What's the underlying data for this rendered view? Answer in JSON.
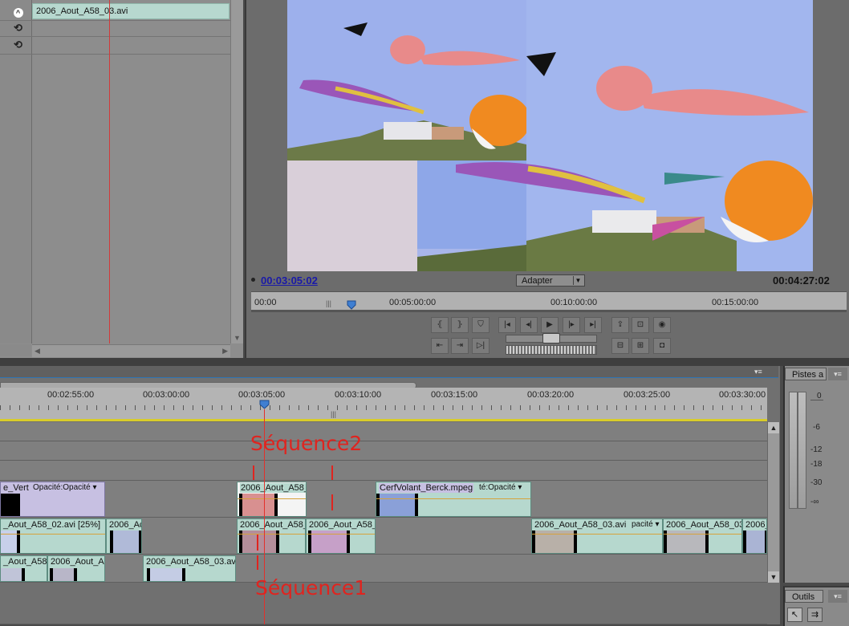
{
  "effect_controls": {
    "clip_name": "2006_Aout_A58_03.avi",
    "icons": [
      "toggle-effect-icon",
      "reset-icon",
      "reset-icon"
    ]
  },
  "monitor": {
    "current_time": "00:03:05:02",
    "duration": "00:04:27:02",
    "fit_option": "Adapter",
    "ruler_labels": [
      "00:00",
      "00:05:00:00",
      "00:10:00:00",
      "00:15:00:00"
    ]
  },
  "timeline": {
    "ruler_labels": [
      "00:02:55:00",
      "00:03:00:00",
      "00:03:05:00",
      "00:03:10:00",
      "00:03:15:00",
      "00:03:20:00",
      "00:03:25:00",
      "00:03:30:00"
    ],
    "track_v3": [
      {
        "name": "e_Vert",
        "suffix": "Opacité:Opacité",
        "style": "purple"
      },
      {
        "name": "2006_Aout_A58_",
        "suffix": ""
      },
      {
        "name": "CerfVolant_Berck.mpeg",
        "suffix": "té:Opacité"
      }
    ],
    "track_v2": [
      {
        "name": "_Aout_A58_02.avi [25%]"
      },
      {
        "name": "2006_Ac"
      },
      {
        "name": "2006_Aout_A58_"
      },
      {
        "name": "2006_Aout_A58_"
      },
      {
        "name": "2006_Aout_A58_03.avi",
        "suffix": "pacité"
      },
      {
        "name": "2006_Aout_A58_03"
      },
      {
        "name": "2006_"
      }
    ],
    "track_v1": [
      {
        "name": "_Aout_A58_"
      },
      {
        "name": "2006_Aout_A"
      },
      {
        "name": "2006_Aout_A58_03.av"
      }
    ]
  },
  "annotations": {
    "sequence2": "Séquence2",
    "sequence1": "Séquence1",
    "color": "#e0241f"
  },
  "audio_meters": {
    "tab_label": "Pistes a",
    "labels": [
      "0",
      "-6",
      "-12",
      "-18",
      "-30",
      "-∞"
    ]
  },
  "tools": {
    "tab_label": "Outils"
  }
}
